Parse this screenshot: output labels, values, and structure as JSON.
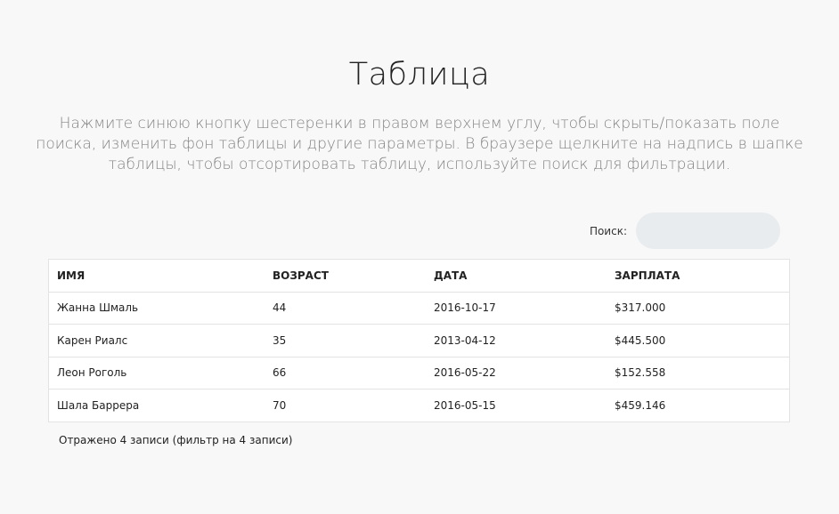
{
  "page": {
    "title": "Таблица",
    "subtitle": "Нажмите синюю кнопку шестеренки в правом верхнем углу, чтобы скрыть/показать поле поиска, изменить фон таблицы и другие параметры. В браузере щелкните на надпись в шапке таблицы, чтобы отсортировать таблицу, используйте поиск для фильтрации."
  },
  "search": {
    "label": "Поиск:",
    "value": "",
    "placeholder": ""
  },
  "table": {
    "columns": [
      "ИМЯ",
      "ВОЗРАСТ",
      "ДАТА",
      "ЗАРПЛАТА"
    ],
    "rows": [
      [
        "Жанна Шмаль",
        "44",
        "2016-10-17",
        "$317.000"
      ],
      [
        "Карен Риалс",
        "35",
        "2013-04-12",
        "$445.500"
      ],
      [
        "Леон Роголь",
        "66",
        "2016-05-22",
        "$152.558"
      ],
      [
        "Шала Баррера",
        "70",
        "2016-05-15",
        "$459.146"
      ]
    ]
  },
  "info": {
    "text": "Отражено 4 записи (фильтр на 4 записи)"
  }
}
